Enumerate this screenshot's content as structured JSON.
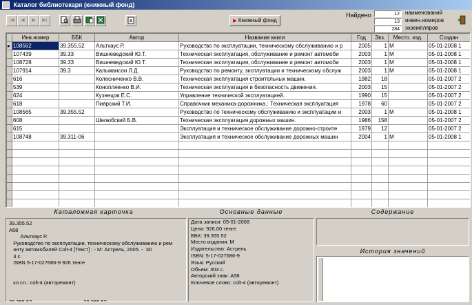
{
  "window": {
    "title": "Каталог библиотекаря (книжный фонд)"
  },
  "toolbar": {
    "fund_button": "Книжный фонд"
  },
  "stats": {
    "found_label": "Найдено",
    "items": [
      {
        "value": "12",
        "label": "наименований"
      },
      {
        "value": "13",
        "label": "инвен.номеров"
      },
      {
        "value": "284",
        "label": "экземпляров"
      }
    ]
  },
  "grid": {
    "columns": [
      "Инв.номер",
      "ББК",
      "Автор",
      "Название книги",
      "Год",
      "Экз.",
      "Место. изд.",
      "Создан"
    ],
    "rows": [
      [
        "108562",
        "39.355.52",
        "Альтхаус Р.",
        "Руководство по эксплуатации, техническому обслуживанию и р",
        "2005",
        "1",
        "М",
        "05-01-2008 1"
      ],
      [
        "107439",
        "39.33",
        "Вишневедский Ю.Т.",
        "Техническая эксплуатация, обслуживание и ремонт автомоби",
        "2003",
        "1",
        "М",
        "05-01-2008 1"
      ],
      [
        "108728",
        "39.33",
        "Вишневедский Ю.Т.",
        "Техническая эксплуатация, обслуживание и ремонт автомоби",
        "2003",
        "1",
        "М",
        "05-01-2008 1"
      ],
      [
        "107914",
        "39.3",
        "Кальмансон Л.Д.",
        "Руководство по ремонту, эксплуатации и техническому обслуж",
        "2003",
        "1",
        "М",
        "05-01-2008 1"
      ],
      [
        "616",
        "",
        "Колесниченко В.В.",
        "Техническая эксплуатация строительных машин.",
        "1982",
        "18",
        "",
        "05-01-2007 2"
      ],
      [
        "539",
        "",
        "Конопляенко В.И.",
        "Техническая эксплуатация и безопасность движения.",
        "2003",
        "15",
        "",
        "05-01-2007 2"
      ],
      [
        "624",
        "",
        "Кузнецов Е.С.",
        "Управление технической эксплуатацией.",
        "1990",
        "15",
        "",
        "05-01-2007 2"
      ],
      [
        "618",
        "",
        "Пиярский Т.И.",
        "Справочник механика-дорожника.: Техническая эксплуатация",
        "1978",
        "60",
        "",
        "05-01-2007 2"
      ],
      [
        "108565",
        "39.355.52",
        "",
        "Руководство по техническому обслуживанию и эксплуатации и",
        "2003",
        "1",
        "М",
        "05-01-2008 1"
      ],
      [
        "608",
        "",
        "Шелюбский Б.В.",
        "Техническая эксплуатация дорожных машин.",
        "1986",
        "158",
        "",
        "05-01-2007 2"
      ],
      [
        "615",
        "",
        "",
        "Эксплуатация и техническое обслуживание дорожно-строите",
        "1979",
        "12",
        "",
        "05-01-2007 2"
      ],
      [
        "108748",
        "39.311-06",
        "",
        "Эксплуатация и техническое обслуживание дорожных машин",
        "2004",
        "1",
        "М",
        "05-01-2008 1"
      ]
    ]
  },
  "panels": {
    "catalog_card": {
      "title": "Каталожная карточка",
      "lines": [
        "39.355.52",
        "А58",
        "        Альтхаус Р.",
        "   Руководство по эксплуатации, техническому обслуживанию и рем",
        "   онту автомобилей Colt-4 [Текст] : - М: Астрель, 2005. -  30",
        "   3 с.",
        "   ISBN 5-17-027686-9 926 тенге",
        "",
        "",
        "   кл.сл.: colt-4 (авторемонт)",
        "",
        "",
        "39.355.52                                    39.355.52"
      ]
    },
    "main_data": {
      "title": "Основные данные",
      "lines": [
        "Дата записи: 05-01-2008",
        "Цена: 926.00 тенге",
        "ББК: 39.355.52",
        "Место издания: М",
        "Издательство: Астрель",
        "ISBN: 5-17-027686-9",
        "Язык: Русский",
        "Объем: 303 с.",
        "Авторский знак: А58",
        "Ключевое слово: colt-4 (авторемонт)"
      ]
    },
    "contents": {
      "title": "Содержание"
    },
    "history": {
      "title": "История значений"
    }
  }
}
